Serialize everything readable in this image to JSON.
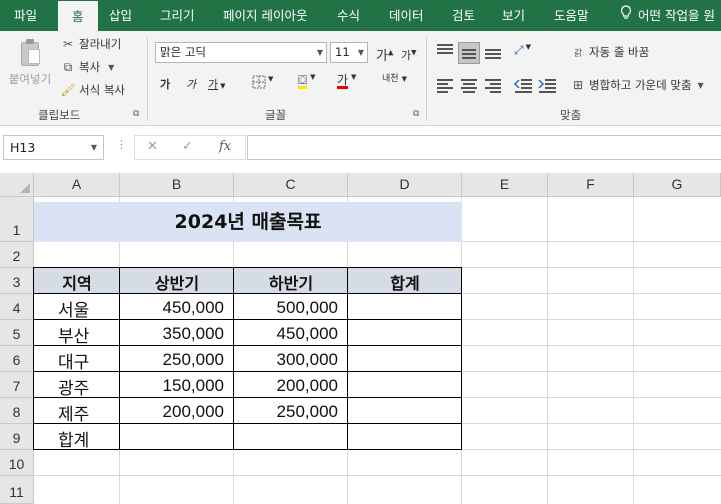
{
  "tabs": [
    "파일",
    "홈",
    "삽입",
    "그리기",
    "페이지 레이아웃",
    "수식",
    "데이터",
    "검토",
    "보기",
    "도움말",
    "어떤 작업을 원"
  ],
  "active_tab": "홈",
  "ribbon": {
    "clipboard": {
      "paste": "붙여넣기",
      "cut": "잘라내기",
      "copy": "복사",
      "format_painter": "서식 복사",
      "label": "클립보드"
    },
    "font": {
      "name": "맑은 고딕",
      "size": "11",
      "bold": "가",
      "italic": "가",
      "underline": "가",
      "grow": "가",
      "shrink": "가",
      "font_color": "가",
      "phonetic": "내천",
      "label": "글꼴"
    },
    "alignment": {
      "wrap": "자동 줄 바꿈",
      "merge": "병합하고 가운데 맞춤",
      "label": "맞춤",
      "wrap_icon_text": "갉"
    }
  },
  "formula_bar": {
    "name_box": "H13",
    "fx": "fx",
    "value": ""
  },
  "columns": [
    "A",
    "B",
    "C",
    "D",
    "E",
    "F",
    "G"
  ],
  "rows": [
    "1",
    "2",
    "3",
    "4",
    "5",
    "6",
    "7",
    "8",
    "9",
    "10",
    "11"
  ],
  "sheet": {
    "title": "2024년 매출목표",
    "headers": [
      "지역",
      "상반기",
      "하반기",
      "합계"
    ],
    "data": [
      {
        "region": "서울",
        "h1": "450,000",
        "h2": "500,000"
      },
      {
        "region": "부산",
        "h1": "350,000",
        "h2": "450,000"
      },
      {
        "region": "대구",
        "h1": "250,000",
        "h2": "300,000"
      },
      {
        "region": "광주",
        "h1": "150,000",
        "h2": "200,000"
      },
      {
        "region": "제주",
        "h1": "200,000",
        "h2": "250,000"
      }
    ],
    "total_label": "합계"
  },
  "colors": {
    "brand": "#217346",
    "title_fill": "#dae3f3",
    "header_fill": "#d6dce4"
  }
}
